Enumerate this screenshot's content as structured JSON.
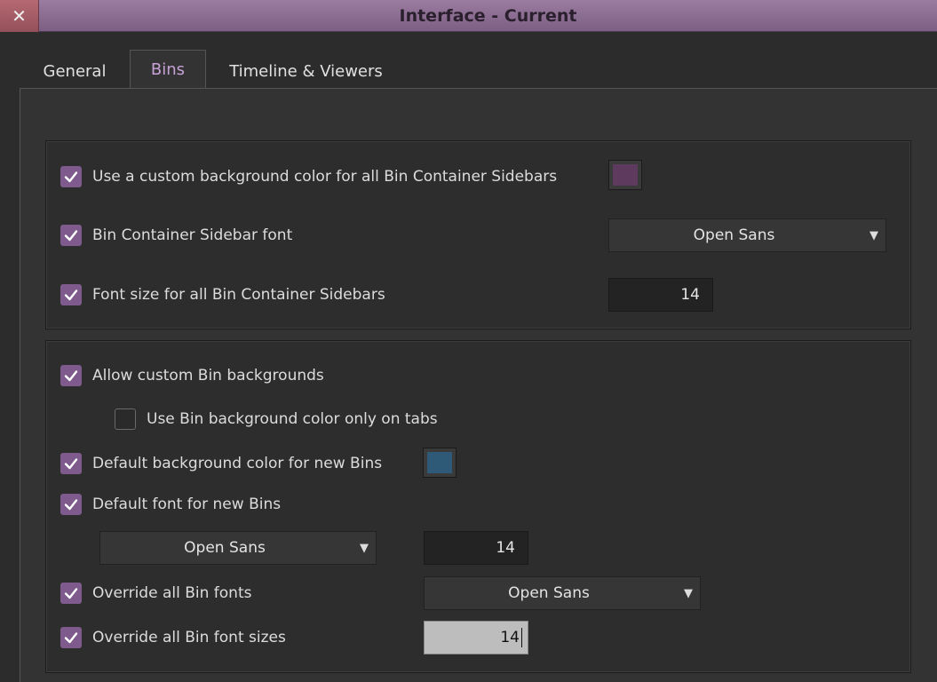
{
  "window": {
    "title": "Interface - Current",
    "close_glyph": "✕"
  },
  "tabs": [
    {
      "label": "General",
      "selected": false
    },
    {
      "label": "Bins",
      "selected": true
    },
    {
      "label": "Timeline & Viewers",
      "selected": false
    }
  ],
  "group1": {
    "custom_sidebar_bg": {
      "label": "Use a custom background color for all Bin Container Sidebars",
      "checked": true,
      "color": "#5e3a5e"
    },
    "sidebar_font": {
      "label": "Bin Container Sidebar font",
      "checked": true,
      "value": "Open Sans"
    },
    "sidebar_font_size": {
      "label": "Font size for all Bin Container Sidebars",
      "checked": true,
      "value": "14"
    }
  },
  "group2": {
    "allow_custom_bg": {
      "label": "Allow custom Bin backgrounds",
      "checked": true
    },
    "bg_only_tabs": {
      "label": "Use Bin background color only on tabs",
      "checked": false
    },
    "default_bg": {
      "label": "Default background color for new Bins",
      "checked": true,
      "color": "#2e5a78"
    },
    "default_font": {
      "label": "Default font for new Bins",
      "checked": true,
      "font_value": "Open Sans",
      "size_value": "14"
    },
    "override_fonts": {
      "label": "Override all Bin fonts",
      "checked": true,
      "value": "Open Sans"
    },
    "override_sizes": {
      "label": "Override all Bin font sizes",
      "checked": true,
      "value": "14"
    }
  },
  "colors": {
    "accent": "#7e5b8c",
    "titlebar": "#8c6d92"
  }
}
